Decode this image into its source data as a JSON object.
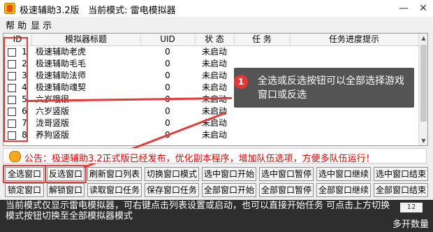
{
  "window": {
    "title": "极速辅助3.2版",
    "mode_label": "当前模式:",
    "mode_value": "雷电模拟器"
  },
  "menu": [
    "帮 助",
    "显 示"
  ],
  "table": {
    "columns": [
      "ID",
      "模拟器标题",
      "UID",
      "状 态",
      "任 务",
      "任务进度提示"
    ],
    "rows": [
      {
        "id": "1",
        "name": "极速辅助老虎",
        "uid": "0",
        "status": "未启动"
      },
      {
        "id": "2",
        "name": "极速辅助毛毛",
        "uid": "0",
        "status": "未启动"
      },
      {
        "id": "3",
        "name": "极速辅助法师",
        "uid": "0",
        "status": "未启动"
      },
      {
        "id": "4",
        "name": "极速辅助魂契",
        "uid": "0",
        "status": "未启动"
      },
      {
        "id": "5",
        "name": "六岁哦很",
        "uid": "0",
        "status": "未启动"
      },
      {
        "id": "6",
        "name": "六岁竖版",
        "uid": "0",
        "status": "未启动"
      },
      {
        "id": "7",
        "name": "泷哥竖版",
        "uid": "0",
        "status": "未启动"
      },
      {
        "id": "8",
        "name": "养狗竖版",
        "uid": "0",
        "status": "未启动"
      }
    ]
  },
  "callout": {
    "badge": "1",
    "text": "全选或反选按钮可以全部选择游戏窗口或反选"
  },
  "notice": {
    "text": "公告：极速辅助3.2正式版已经发布，优化副本程序，增加队伍选项，方便多队伍运行！"
  },
  "buttons_row1": [
    "全选窗口",
    "反选窗口",
    "刷新窗口列表",
    "切换窗口模式",
    "选中窗口开始",
    "选中窗口暂停",
    "选中窗口继续",
    "选中窗口结束"
  ],
  "buttons_row2": [
    "锁定窗口",
    "解锁窗口",
    "读取窗口任务",
    "保存窗口任务",
    "全部窗口开始",
    "全部窗口暂停",
    "全部窗口继续",
    "全部窗口结束"
  ],
  "status_bar": {
    "text": "当前模式仅显示雷电模拟器，可右键点击列表设置或启动，也可以直接开始任务 可点击上方切换模式按钮切换至全部模拟器模式",
    "counter": "12",
    "caption": "多开数量"
  },
  "colors": {
    "highlight": "#e53935",
    "notice_text": "#e00000",
    "status_bg": "#2e2e2e"
  }
}
